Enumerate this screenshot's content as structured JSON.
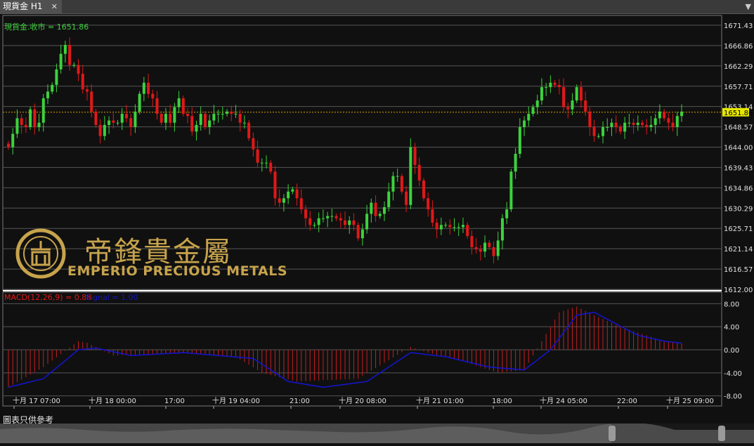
{
  "tab": {
    "title": "現貨金 H1",
    "close": "✕",
    "dropdown": "▼"
  },
  "main_label": "現貨金.收市 = 1651.86",
  "macd_label": {
    "macd": "MACD(12,26,9) = 0.88",
    "signal": "Signal = 1.00"
  },
  "footer": "圖表只供參考",
  "logo": {
    "cn": "帝鋒貴金屬",
    "en": "EMPERIO PRECIOUS METALS"
  },
  "colors": {
    "up": "#3cd23c",
    "down": "#e01818",
    "signal": "#1414c8",
    "macd": "#c81e1e",
    "grid": "#555555",
    "price_line": "#d6a000"
  },
  "chart_data": [
    {
      "type": "candlestick",
      "title": "現貨金 H1",
      "price_axis_ticks": [
        1671.43,
        1666.86,
        1662.29,
        1657.71,
        1653.14,
        1648.57,
        1644.0,
        1639.43,
        1634.86,
        1630.29,
        1625.71,
        1621.14,
        1616.57,
        1612.0
      ],
      "ylim": [
        1612.0,
        1673.0
      ],
      "last_price": "1651.86",
      "x_ticks": [
        "十月 17 07:00",
        "十月 18 00:00",
        "17:00",
        "十月 19 04:00",
        "21:00",
        "十月 20 08:00",
        "十月 21 01:00",
        "18:00",
        "十月 24 05:00",
        "22:00",
        "十月 25 09:00"
      ],
      "close": [
        1644.0,
        1647.0,
        1650.5,
        1649.0,
        1648.5,
        1652.5,
        1648.5,
        1649.5,
        1655.0,
        1656.5,
        1658.0,
        1661.5,
        1665.0,
        1667.0,
        1662.5,
        1662.5,
        1660.5,
        1657.0,
        1656.5,
        1652.0,
        1649.0,
        1646.5,
        1649.0,
        1650.0,
        1649.5,
        1649.5,
        1651.5,
        1650.5,
        1648.5,
        1652.0,
        1656.0,
        1658.5,
        1656.0,
        1655.0,
        1651.5,
        1649.5,
        1651.5,
        1649.5,
        1653.0,
        1655.0,
        1651.5,
        1651.0,
        1647.5,
        1649.0,
        1651.5,
        1648.5,
        1650.0,
        1651.5,
        1651.5,
        1651.5,
        1652.0,
        1651.5,
        1651.5,
        1649.5,
        1649.5,
        1646.0,
        1643.5,
        1640.5,
        1640.5,
        1640.5,
        1638.5,
        1632.5,
        1631.5,
        1632.5,
        1634.0,
        1634.5,
        1632.5,
        1630.0,
        1628.0,
        1626.5,
        1626.5,
        1628.0,
        1628.0,
        1628.5,
        1628.5,
        1628.0,
        1627.5,
        1626.5,
        1627.5,
        1626.5,
        1623.5,
        1625.5,
        1629.0,
        1631.5,
        1628.5,
        1629.0,
        1630.5,
        1634.0,
        1637.5,
        1637.5,
        1634.0,
        1631.0,
        1644.0,
        1640.0,
        1636.5,
        1632.5,
        1630.0,
        1627.0,
        1625.5,
        1626.5,
        1626.5,
        1626.0,
        1626.0,
        1626.0,
        1626.5,
        1624.0,
        1621.5,
        1621.0,
        1620.5,
        1622.5,
        1621.5,
        1619.5,
        1623.0,
        1628.0,
        1630.0,
        1638.5,
        1642.5,
        1648.5,
        1650.0,
        1651.5,
        1653.0,
        1654.5,
        1657.5,
        1657.5,
        1658.5,
        1658.0,
        1657.5,
        1653.0,
        1652.5,
        1654.5,
        1657.5,
        1654.5,
        1652.0,
        1648.5,
        1646.5,
        1646.5,
        1648.5,
        1648.5,
        1649.5,
        1648.5,
        1647.5,
        1649.5,
        1649.5,
        1649.0,
        1649.5,
        1649.0,
        1648.5,
        1649.0,
        1650.5,
        1652.0,
        1650.5,
        1649.5,
        1648.5,
        1651.0,
        1652.0
      ],
      "ohlc_note": "open = previous close; wicks estimated"
    },
    {
      "type": "bar+line",
      "title": "MACD(12,26,9)",
      "series": [
        {
          "name": "MACD(12,26,9) = 0.88",
          "style": "histogram"
        },
        {
          "name": "Signal = 1.00",
          "style": "line"
        }
      ],
      "y_ticks": [
        8.0,
        4.0,
        0.0,
        -4.0,
        -8.0
      ],
      "ylim": [
        -9.5,
        9.5
      ],
      "macd_keypoints": [
        [
          0,
          -6.5
        ],
        [
          8,
          -3.0
        ],
        [
          16,
          1.5
        ],
        [
          18,
          1.2
        ],
        [
          24,
          -1.0
        ],
        [
          40,
          -0.5
        ],
        [
          52,
          -1.2
        ],
        [
          58,
          -4.0
        ],
        [
          66,
          -5.5
        ],
        [
          80,
          -5.0
        ],
        [
          92,
          0.5
        ],
        [
          96,
          -0.5
        ],
        [
          104,
          -2.0
        ],
        [
          112,
          -4.0
        ],
        [
          118,
          -3.5
        ],
        [
          122,
          1.5
        ],
        [
          126,
          6.5
        ],
        [
          130,
          7.5
        ],
        [
          134,
          6.0
        ],
        [
          140,
          4.0
        ],
        [
          150,
          1.5
        ],
        [
          156,
          0.88
        ]
      ],
      "signal_keypoints": [
        [
          0,
          -6.5
        ],
        [
          8,
          -5.0
        ],
        [
          16,
          0.0
        ],
        [
          20,
          0.3
        ],
        [
          28,
          -1.0
        ],
        [
          40,
          -0.5
        ],
        [
          56,
          -1.5
        ],
        [
          64,
          -5.5
        ],
        [
          72,
          -6.5
        ],
        [
          82,
          -5.5
        ],
        [
          92,
          -0.5
        ],
        [
          100,
          -1.2
        ],
        [
          110,
          -3.0
        ],
        [
          118,
          -3.5
        ],
        [
          124,
          0.0
        ],
        [
          130,
          6.0
        ],
        [
          134,
          6.5
        ],
        [
          144,
          2.5
        ],
        [
          150,
          1.5
        ],
        [
          156,
          1.0
        ]
      ]
    }
  ]
}
